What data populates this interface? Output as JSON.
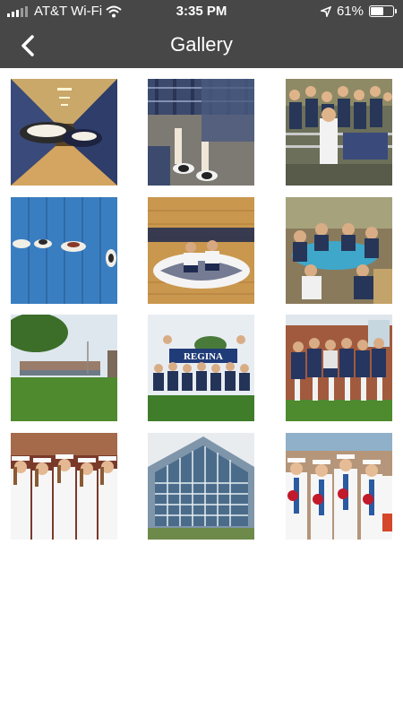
{
  "status_bar": {
    "carrier": "AT&T Wi-Fi",
    "time": "3:35 PM",
    "battery_percent": "61%",
    "battery_level": 0.61
  },
  "nav": {
    "title": "Gallery",
    "back_icon": "chevron-left-icon"
  },
  "gallery": {
    "photos": [
      {
        "name": "photo-shoes-hallway"
      },
      {
        "name": "photo-plaid-skirts-saddle-shoes"
      },
      {
        "name": "photo-students-bleachers"
      },
      {
        "name": "photo-shoes-on-lockers"
      },
      {
        "name": "photo-students-gym-floor-logo"
      },
      {
        "name": "photo-students-classroom-tables"
      },
      {
        "name": "photo-school-campus-lawn"
      },
      {
        "name": "photo-group-regina-sign",
        "sign_text": "REGINA"
      },
      {
        "name": "photo-group-brick-building"
      },
      {
        "name": "photo-graduates-white-gowns"
      },
      {
        "name": "photo-school-building-glass-facade"
      },
      {
        "name": "photo-graduates-roses"
      }
    ]
  }
}
